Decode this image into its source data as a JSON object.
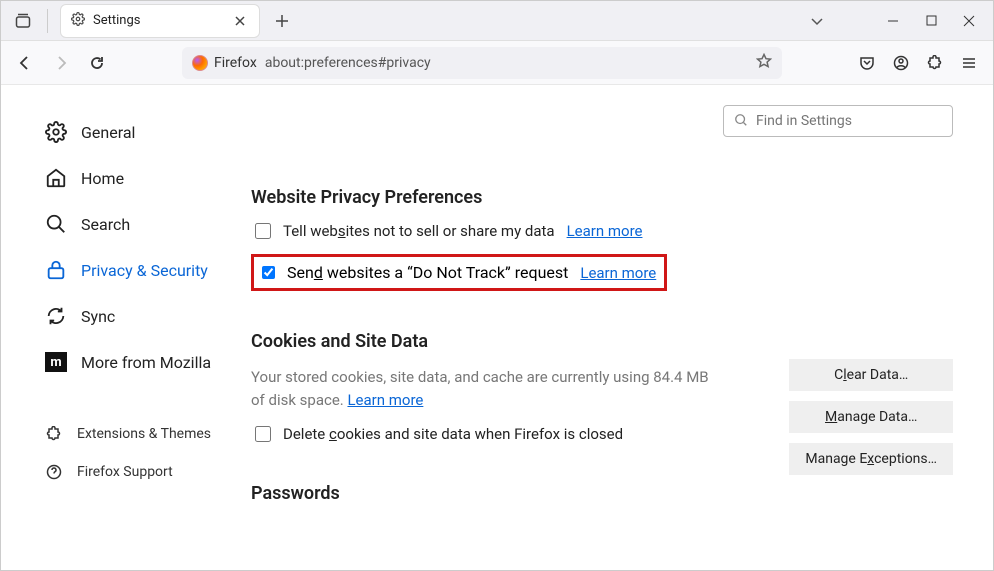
{
  "tab": {
    "title": "Settings"
  },
  "urlbar": {
    "label": "Firefox",
    "url": "about:preferences#privacy"
  },
  "search": {
    "placeholder": "Find in Settings"
  },
  "sidebar": {
    "items": [
      {
        "label": "General"
      },
      {
        "label": "Home"
      },
      {
        "label": "Search"
      },
      {
        "label": "Privacy & Security"
      },
      {
        "label": "Sync"
      },
      {
        "label": "More from Mozilla"
      }
    ],
    "secondary": [
      {
        "label": "Extensions & Themes"
      },
      {
        "label": "Firefox Support"
      }
    ]
  },
  "privacy": {
    "title": "Website Privacy Preferences",
    "row1": {
      "label": "Tell websites not to sell or share my data",
      "link": "Learn more"
    },
    "row2": {
      "label": "Send websites a “Do Not Track” request",
      "link": "Learn more"
    }
  },
  "cookies": {
    "title": "Cookies and Site Data",
    "desc_a": "Your stored cookies, site data, and cache are currently using 84.4 MB of disk space. ",
    "desc_link": "Learn more",
    "delete_label": "Delete cookies and site data when Firefox is closed",
    "btn_clear": "Clear Data…",
    "btn_manage": "Manage Data…",
    "btn_exceptions": "Manage Exceptions…"
  },
  "passwords": {
    "title": "Passwords"
  }
}
